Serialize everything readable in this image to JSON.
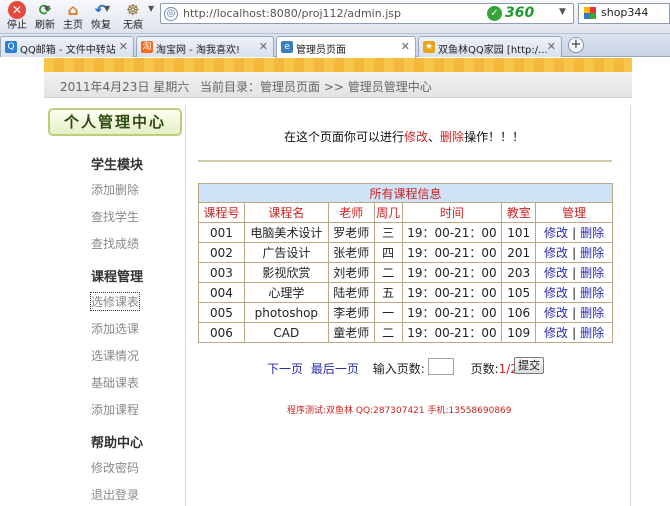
{
  "browser": {
    "buttons": [
      {
        "label": "停止",
        "icon": "stop-icon",
        "glyph": "✕"
      },
      {
        "label": "刷新",
        "icon": "refresh-icon",
        "glyph": "⟳"
      },
      {
        "label": "主页",
        "icon": "home-icon",
        "glyph": "⌂"
      },
      {
        "label": "恢复",
        "icon": "restore-icon",
        "glyph": "↶"
      },
      {
        "label": "无痕",
        "icon": "paw-icon",
        "glyph": "☸"
      }
    ],
    "address": "http://localhost:8080/proj112/admin.jsp",
    "brand": "360",
    "search_text": "shop344",
    "tabs": [
      {
        "label": "QQ邮箱 - 文件中转站",
        "icon": "Q",
        "color": "#2a7fd4"
      },
      {
        "label": "淘宝网 - 淘我喜欢!",
        "icon": "淘",
        "color": "#f06b1c"
      },
      {
        "label": "管理员页面",
        "icon": "e",
        "color": "#3a7dc4"
      },
      {
        "label": "双鱼林QQ家园 [http:/...",
        "icon": "★",
        "color": "#e5a61c"
      }
    ],
    "new_tab": "+"
  },
  "header": {
    "date": "2011年4月23日  星期六",
    "breadcrumb": "当前目录：管理员页面 >> 管理员管理中心"
  },
  "sidebar": {
    "title": "个人管理中心",
    "sections": [
      {
        "heading": "学生模块",
        "items": [
          "添加删除",
          "查找学生",
          "查找成绩"
        ]
      },
      {
        "heading": "课程管理",
        "items": [
          "选修课表",
          "添加选课",
          "选课情况",
          "基础课表",
          "添加课程"
        ]
      },
      {
        "heading": "帮助中心",
        "items": [
          "修改密码",
          "退出登录"
        ]
      }
    ]
  },
  "main": {
    "prompt_pre": "在这个页面你可以进行",
    "prompt_edit": "修改",
    "prompt_sep": "、",
    "prompt_delete": "删除",
    "prompt_post": "操作！！！",
    "table": {
      "caption": "所有课程信息",
      "headers": [
        "课程号",
        "课程名",
        "老师",
        "周几",
        "时间",
        "教室",
        "管理"
      ],
      "rows": [
        [
          "001",
          "电脑美术设计",
          "罗老师",
          "三",
          "19：00-21：00",
          "101"
        ],
        [
          "002",
          "广告设计",
          "张老师",
          "四",
          "19：00-21：00",
          "201"
        ],
        [
          "003",
          "影视欣赏",
          "刘老师",
          "二",
          "19：00-21：00",
          "203"
        ],
        [
          "004",
          "心理学",
          "陆老师",
          "五",
          "19：00-21：00",
          "105"
        ],
        [
          "005",
          "photoshop",
          "李老师",
          "一",
          "19：00-21：00",
          "106"
        ],
        [
          "006",
          "CAD",
          "童老师",
          "二",
          "19：00-21：00",
          "109"
        ]
      ],
      "edit_label": "修改",
      "delete_label": "删除",
      "sep": "|"
    },
    "pager": {
      "next": "下一页",
      "last": "最后一页",
      "input_label": "输入页数:",
      "pages_label": "页数:",
      "pages_value": "1/2",
      "submit": "提交"
    },
    "footer": "程序测试:双鱼林 QQ:287307421 手机:13558690869"
  }
}
